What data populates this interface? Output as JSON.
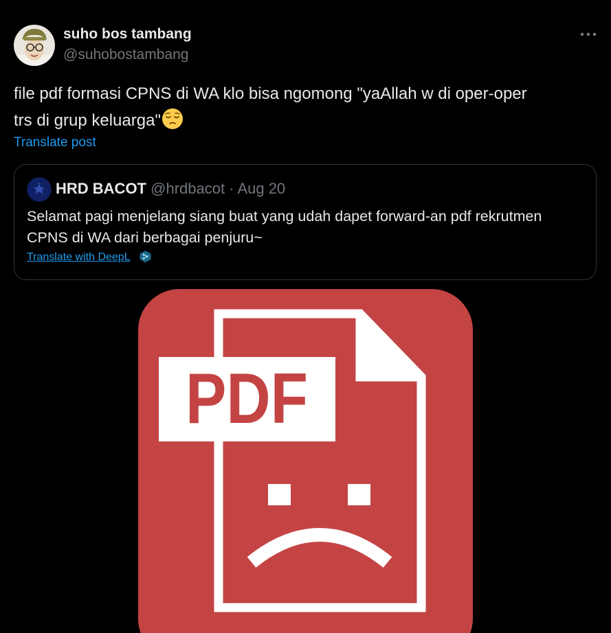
{
  "post": {
    "display_name": "suho bos tambang",
    "handle": "@suhobostambang",
    "text_line1": "file pdf formasi CPNS di WA klo bisa ngomong \"yaAllah w di oper-oper",
    "text_line2": "trs di grup keluarga\"",
    "translate_label": "Translate post",
    "more_icon": "ellipsis-icon",
    "emoji": "relieved-face-emoji"
  },
  "quote": {
    "display_name": "HRD BACOT",
    "handle": "@hrdbacot",
    "separator": "·",
    "date": "Aug 20",
    "text_line1": "Selamat pagi menjelang siang buat yang udah dapet forward-an pdf rekrutmen",
    "text_line2": "CPNS di WA dari berbagai penjuru~",
    "translate_label": "Translate with DeepL",
    "translate_icon": "deepl-icon"
  },
  "media": {
    "label": "PDF",
    "description_icon": "sad-pdf-file-icon"
  },
  "colors": {
    "background": "#000000",
    "text_primary": "#e7e9ea",
    "text_secondary": "#71767b",
    "link": "#1d9bf0",
    "border": "#2f3336",
    "pdf_red": "#c44444"
  }
}
